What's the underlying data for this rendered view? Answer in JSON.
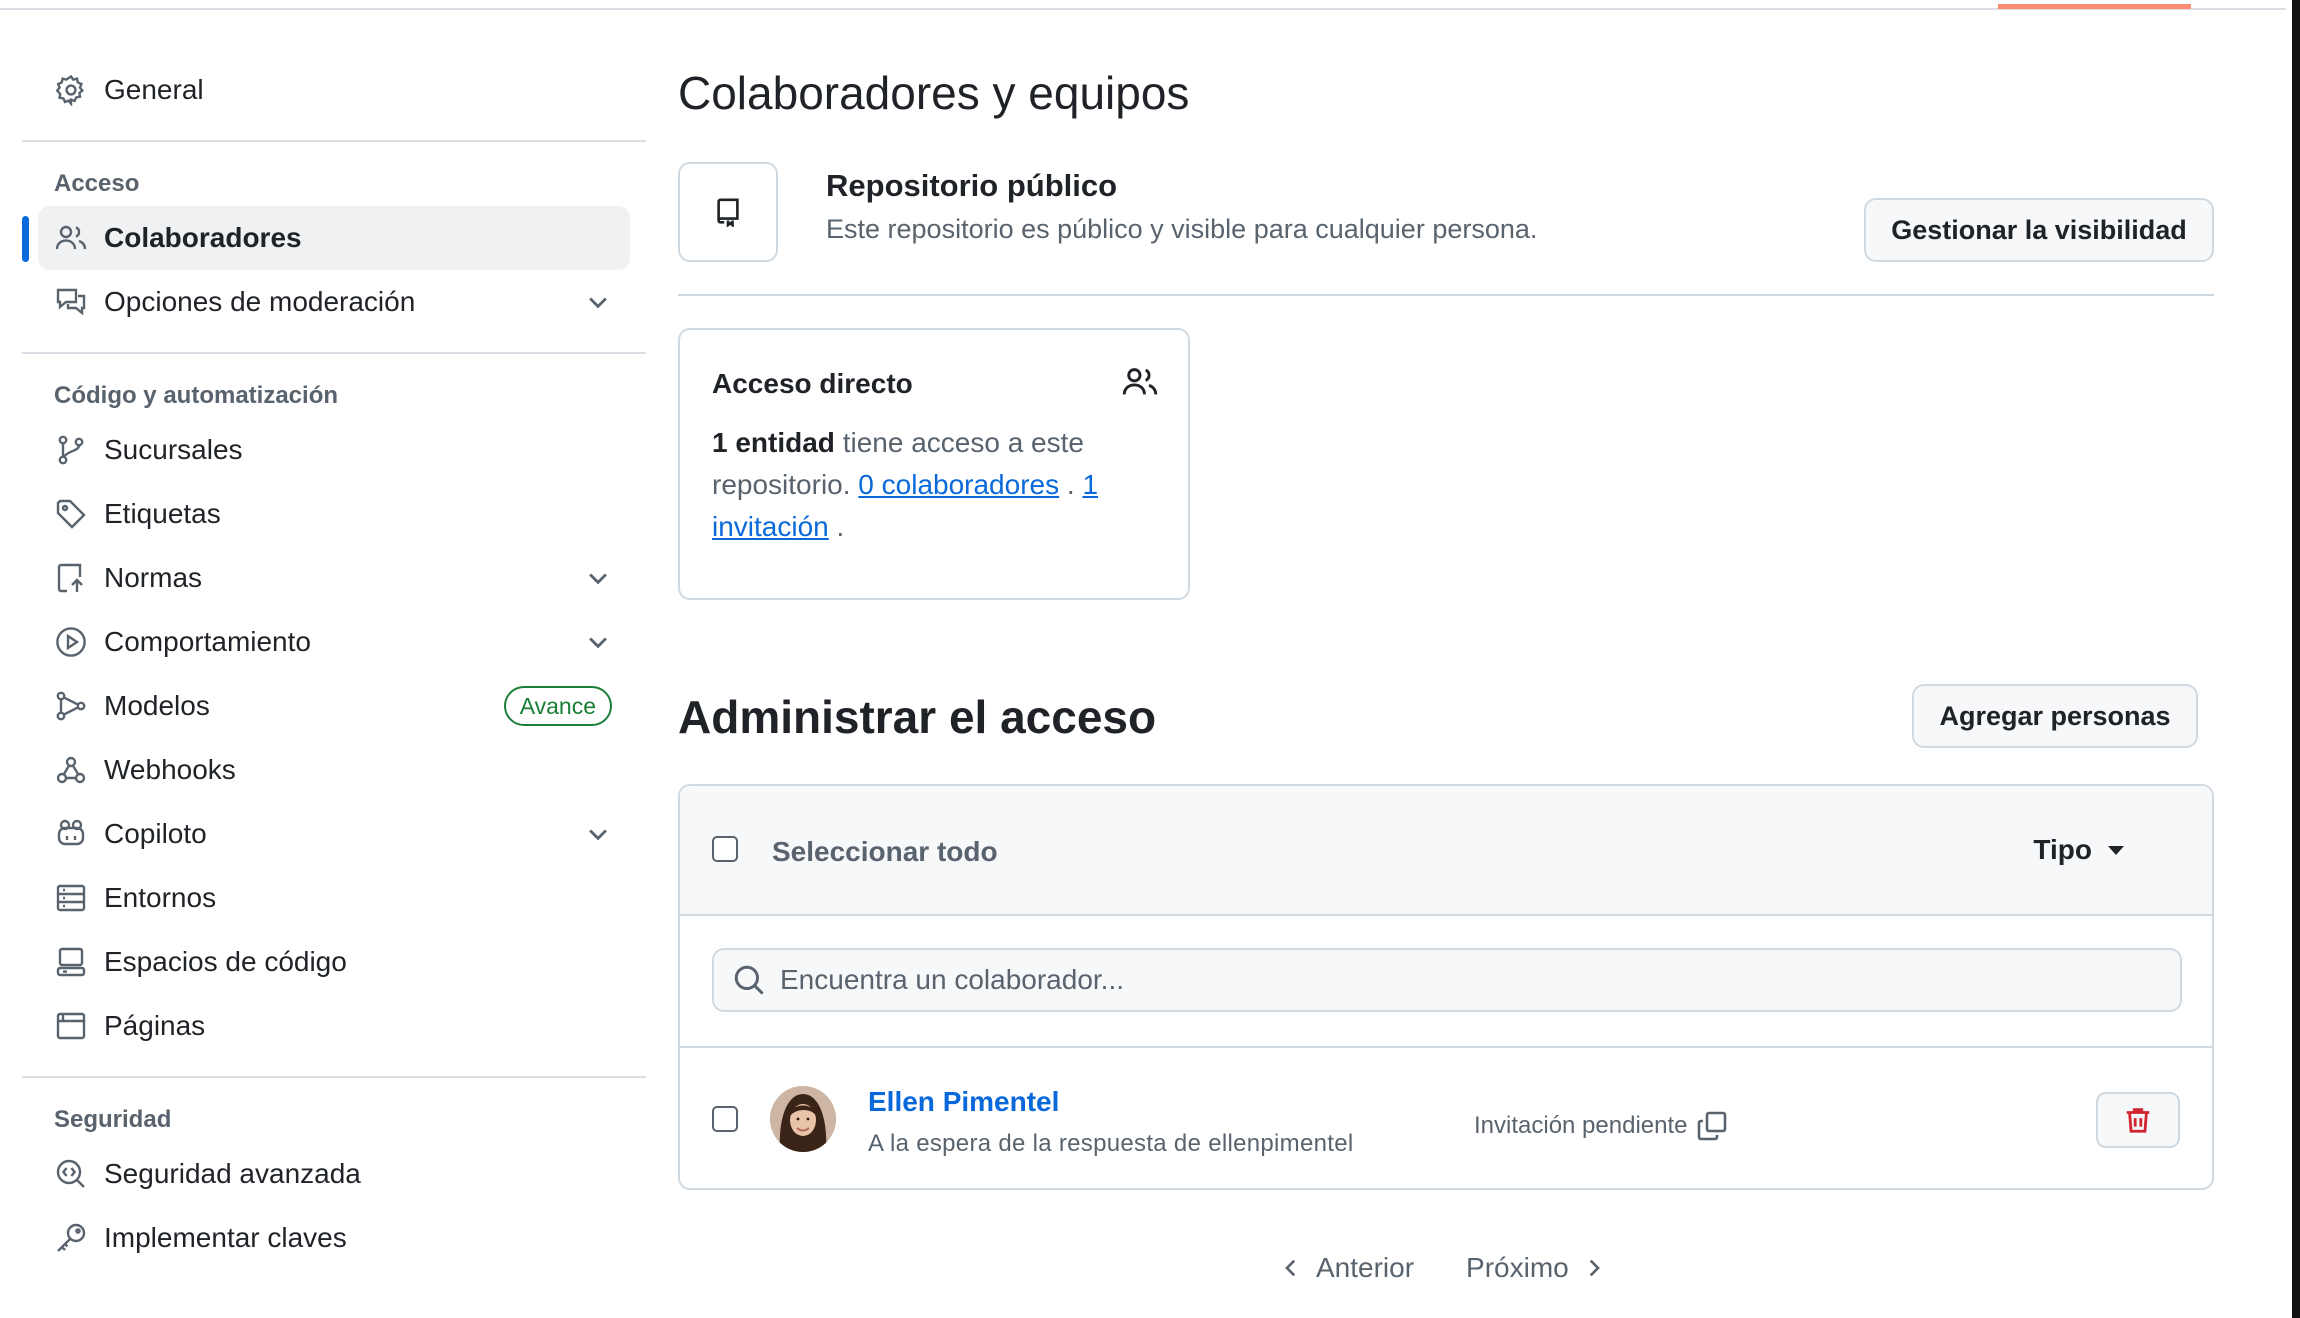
{
  "sidebar": {
    "general": "General",
    "sections": {
      "access": "Acceso",
      "code": "Código y automatización",
      "security": "Seguridad"
    },
    "access_items": [
      {
        "label": "Colaboradores",
        "icon": "people-icon",
        "active": true
      },
      {
        "label": "Opciones de moderación",
        "icon": "comment-discussion-icon",
        "expandable": true
      }
    ],
    "code_items": [
      {
        "label": "Sucursales",
        "icon": "git-branch-icon"
      },
      {
        "label": "Etiquetas",
        "icon": "tag-icon"
      },
      {
        "label": "Normas",
        "icon": "repo-push-icon",
        "expandable": true
      },
      {
        "label": "Comportamiento",
        "icon": "play-icon",
        "expandable": true
      },
      {
        "label": "Modelos",
        "icon": "workflow-icon",
        "badge": "Avance"
      },
      {
        "label": "Webhooks",
        "icon": "webhook-icon"
      },
      {
        "label": "Copiloto",
        "icon": "copilot-icon",
        "expandable": true
      },
      {
        "label": "Entornos",
        "icon": "server-icon"
      },
      {
        "label": "Espacios de código",
        "icon": "codespaces-icon"
      },
      {
        "label": "Páginas",
        "icon": "browser-icon"
      }
    ],
    "security_items": [
      {
        "label": "Seguridad avanzada",
        "icon": "codescan-icon"
      },
      {
        "label": "Implementar claves",
        "icon": "key-icon"
      }
    ]
  },
  "main": {
    "title": "Colaboradores y equipos",
    "visibility": {
      "title": "Repositorio público",
      "description": "Este repositorio es público y visible para cualquier persona.",
      "button": "Gestionar la visibilidad"
    },
    "direct_access": {
      "title": "Acceso directo",
      "count_bold": "1 entidad",
      "text1": " tiene acceso a este repositorio. ",
      "link_collaborators": "0 colaboradores",
      "sep": " . ",
      "link_invitations": "1 invitación",
      "end": " ."
    },
    "manage": {
      "title": "Administrar el acceso",
      "add_button": "Agregar personas",
      "select_all": "Seleccionar todo",
      "type_filter": "Tipo",
      "search_placeholder": "Encuentra un colaborador...",
      "rows": [
        {
          "name": "Ellen Pimentel",
          "subtitle": "A la espera de la respuesta de ellenpimentel",
          "status": "Invitación pendiente"
        }
      ]
    },
    "pagination": {
      "prev": "Anterior",
      "next": "Próximo"
    }
  },
  "colors": {
    "accent": "#0969da",
    "success": "#1a7f37",
    "danger": "#d1242f",
    "tab_underline": "#fd8c73"
  }
}
